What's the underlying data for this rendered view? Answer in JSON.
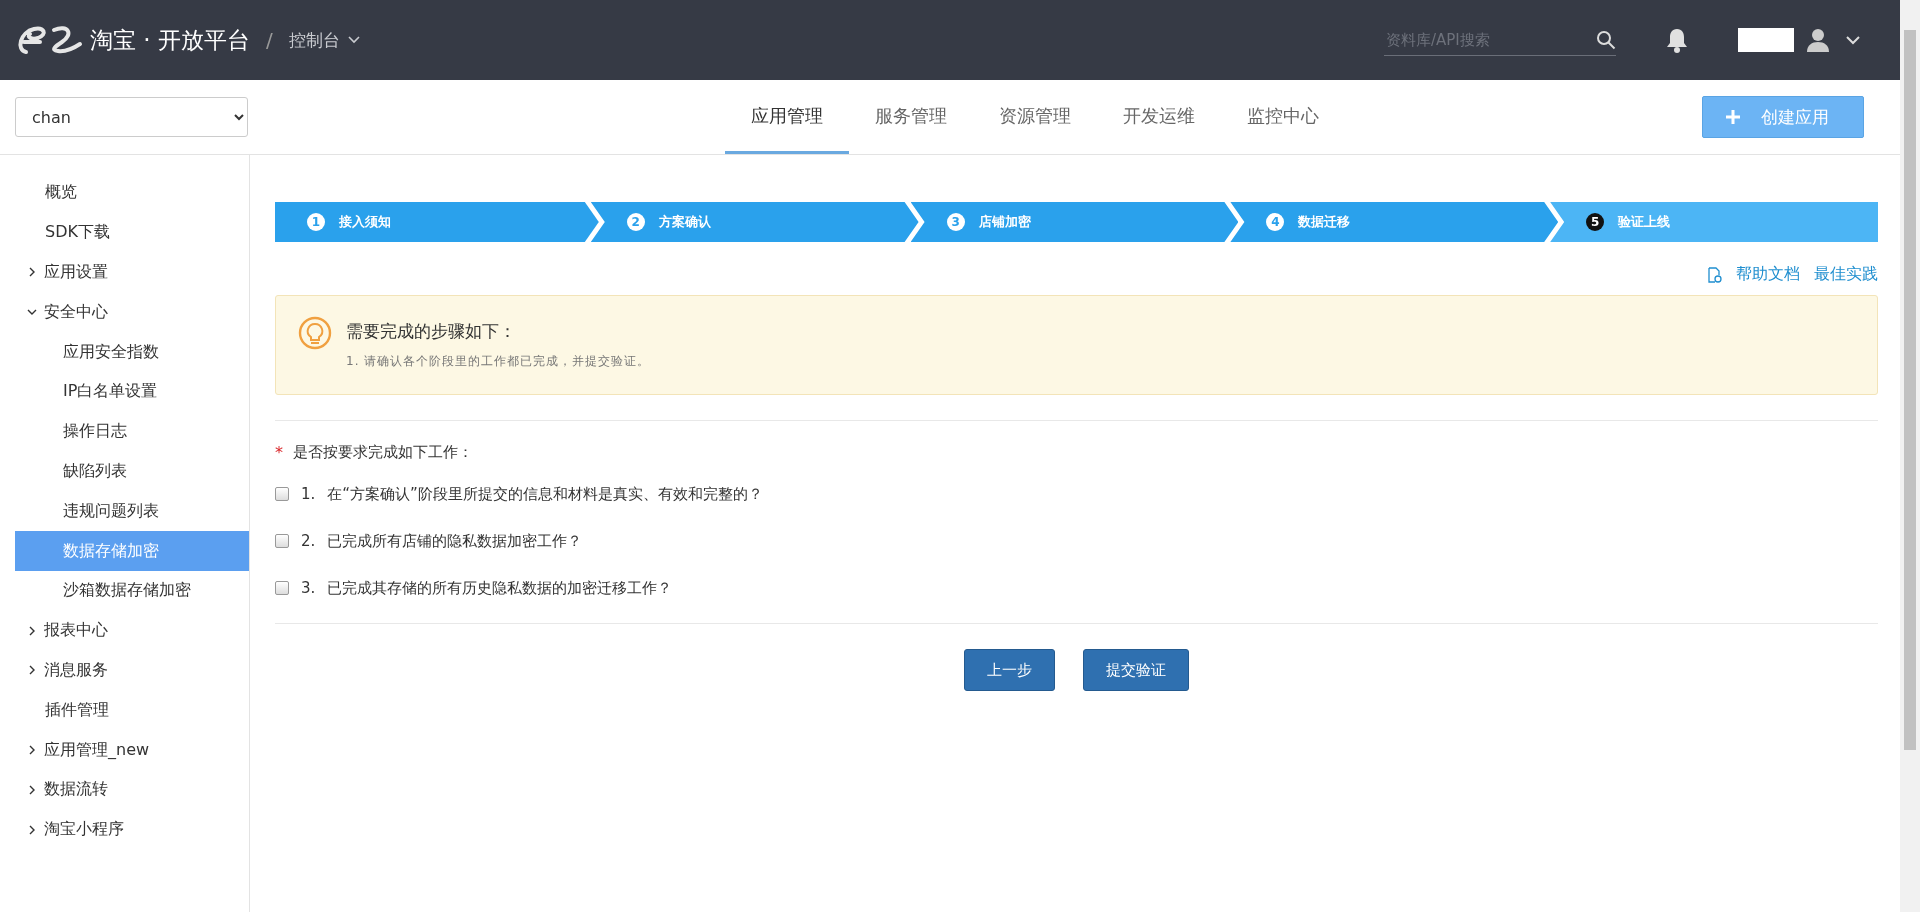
{
  "header": {
    "logo_text": "淘宝 · 开放平台",
    "separator": "/",
    "console": "控制台",
    "search": {
      "placeholder": "资料库/API搜索"
    }
  },
  "app_select": {
    "value": "chan"
  },
  "nav_tabs": [
    {
      "label": "应用管理",
      "selected": true
    },
    {
      "label": "服务管理",
      "selected": false
    },
    {
      "label": "资源管理",
      "selected": false
    },
    {
      "label": "开发运维",
      "selected": false
    },
    {
      "label": "监控中心",
      "selected": false
    }
  ],
  "create_button": {
    "label": "创建应用"
  },
  "sidebar": {
    "items": [
      {
        "label": "概览",
        "selected": false
      },
      {
        "label": "SDK下载",
        "selected": false
      },
      {
        "label": "应用设置",
        "expanded": false,
        "selected": false
      },
      {
        "label": "安全中心",
        "expanded": true,
        "selected": false,
        "children": [
          {
            "label": "应用安全指数",
            "selected": false
          },
          {
            "label": "IP白名单设置",
            "selected": false
          },
          {
            "label": "操作日志",
            "selected": false
          },
          {
            "label": "缺陷列表",
            "selected": false
          },
          {
            "label": "违规问题列表",
            "selected": false
          },
          {
            "label": "数据存储加密",
            "selected": true
          },
          {
            "label": "沙箱数据存储加密",
            "selected": false
          }
        ]
      },
      {
        "label": "报表中心",
        "expanded": false,
        "selected": false
      },
      {
        "label": "消息服务",
        "expanded": false,
        "selected": false
      },
      {
        "label": "插件管理",
        "selected": false
      },
      {
        "label": "应用管理_new",
        "expanded": false,
        "selected": false
      },
      {
        "label": "数据流转",
        "expanded": false,
        "selected": false
      },
      {
        "label": "淘宝小程序",
        "expanded": false,
        "selected": false
      }
    ]
  },
  "steps": [
    {
      "number": "1",
      "label": "接入须知",
      "selected": false
    },
    {
      "number": "2",
      "label": "方案确认",
      "selected": false
    },
    {
      "number": "3",
      "label": "店铺加密",
      "selected": false
    },
    {
      "number": "4",
      "label": "数据迁移",
      "selected": false
    },
    {
      "number": "5",
      "label": "验证上线",
      "selected": true
    }
  ],
  "links": [
    "帮助文档",
    "最佳实践"
  ],
  "notice": {
    "title": "需要完成的步骤如下：",
    "text": "1. 请确认各个阶段里的工作都已完成，并提交验证。"
  },
  "question": {
    "label": "是否按要求完成如下工作：",
    "required_mark": "*"
  },
  "checks": [
    {
      "number": "1.",
      "text": "在“方案确认”阶段里所提交的信息和材料是真实、有效和完整的？",
      "checked": false
    },
    {
      "number": "2.",
      "text": "已完成所有店铺的隐私数据加密工作？",
      "checked": false
    },
    {
      "number": "3.",
      "text": "已完成其存储的所有历史隐私数据的加密迁移工作？",
      "checked": false
    }
  ],
  "buttons": [
    {
      "label": "上一步"
    },
    {
      "label": "提交验证"
    }
  ]
}
